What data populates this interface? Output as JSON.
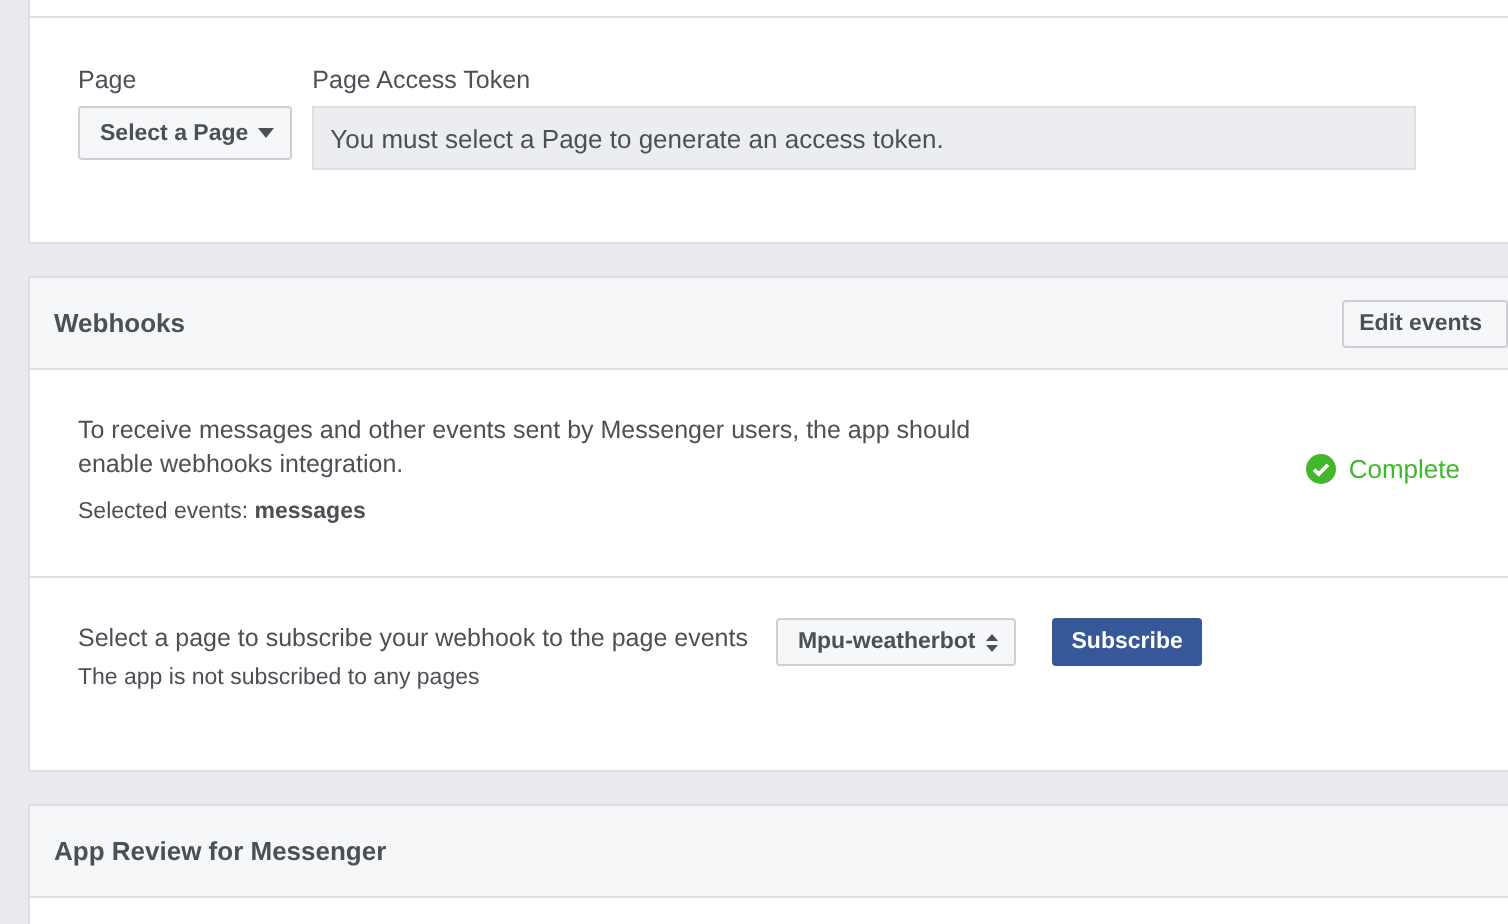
{
  "token_section": {
    "page_label": "Page",
    "page_select": "Select a Page",
    "token_label": "Page Access Token",
    "token_field": "You must select a Page to generate an access token."
  },
  "webhooks": {
    "title": "Webhooks",
    "edit_button": "Edit events",
    "description": "To receive messages and other events sent by Messenger users, the app should enable webhooks integration.",
    "selected_events": "Selected events: **messages**",
    "status": {
      "text": "Complete",
      "complete": true
    },
    "subscribe": {
      "prompt": "Select a page to subscribe your webhook to the page events",
      "note": "The app is not subscribed to any pages",
      "page_select": "Mpu-weatherbot",
      "button": "Subscribe"
    }
  },
  "app_review": {
    "title": "App Review for Messenger"
  }
}
